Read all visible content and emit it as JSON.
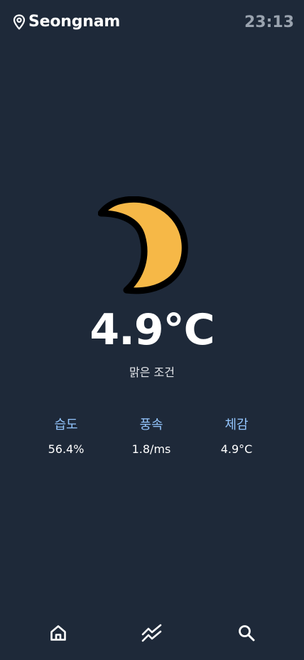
{
  "header": {
    "location_icon": "map-pin-icon",
    "city": "Seongnam",
    "time": "23:13"
  },
  "current": {
    "icon": "crescent-moon-icon",
    "temperature": "4.9°C",
    "condition": "맑은 조건"
  },
  "stats": [
    {
      "label": "습도",
      "value": "56.4%"
    },
    {
      "label": "풍속",
      "value": "1.8/ms"
    },
    {
      "label": "체감",
      "value": "4.9°C"
    }
  ],
  "nav": [
    {
      "icon": "home-icon"
    },
    {
      "icon": "trending-icon"
    },
    {
      "icon": "search-icon"
    }
  ],
  "colors": {
    "background": "#1e2939",
    "moon_fill": "#f6b847",
    "moon_outline": "#000000",
    "label_accent": "#93c5fd",
    "clock": "#9aa3af"
  }
}
